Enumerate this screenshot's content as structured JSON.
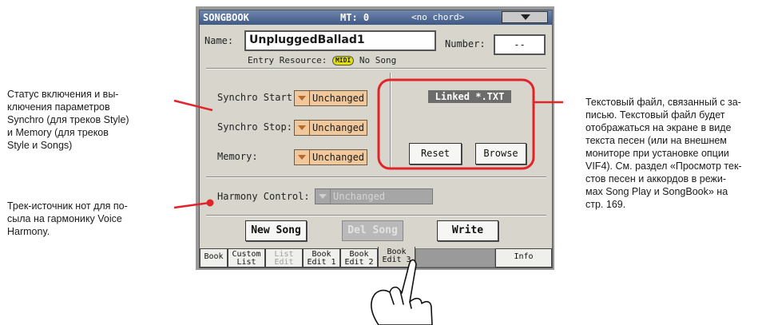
{
  "annotations": {
    "left_top": "Статус включения и вы-\nключения параметров\nSynchro (для треков Style)\nи Memory (для треков\nStyle и Songs)",
    "left_bottom": "Трек-источник нот для по-\nсыла на гармонику Voice\nHarmony.",
    "right": "Текстовый файл, связанный с за-\nписью.  Текстовый файл будет\nотображаться на экране в виде\nтекста песен (или на внешнем\nмониторе при установке опции\nVIF4). См. раздел «Просмотр тек-\nстов песен и аккордов в режи-\nмах Song Play и SongBook» на\nстр. 169."
  },
  "header": {
    "title": "SONGBOOK",
    "mt": "MT: 0",
    "chord": "<no chord>"
  },
  "entry": {
    "name_label": "Name:",
    "name_value": "UnpluggedBallad1",
    "number_label": "Number:",
    "number_value": "--",
    "resource_label": "Entry Resource:",
    "resource_badge": "MIDI",
    "resource_value": "No Song"
  },
  "params": {
    "synchro_start_label": "Synchro Start:",
    "synchro_start_value": "Unchanged",
    "synchro_stop_label": "Synchro Stop:",
    "synchro_stop_value": "Unchanged",
    "memory_label": "Memory:",
    "memory_value": "Unchanged",
    "harmony_label": "Harmony Control:",
    "harmony_value": "Unchanged"
  },
  "linked": {
    "title": "Linked *.TXT",
    "reset": "Reset",
    "browse": "Browse"
  },
  "actions": {
    "new_song": "New Song",
    "del_song": "Del Song",
    "write": "Write"
  },
  "tabs": [
    {
      "l1": "Book",
      "l2": ""
    },
    {
      "l1": "Custom",
      "l2": "List"
    },
    {
      "l1": "List",
      "l2": "Edit"
    },
    {
      "l1": "Book",
      "l2": "Edit 1"
    },
    {
      "l1": "Book",
      "l2": "Edit 2"
    },
    {
      "l1": "Book",
      "l2": "Edit 3"
    },
    {
      "l1": "",
      "l2": ""
    },
    {
      "l1": "Info",
      "l2": ""
    }
  ],
  "colors": {
    "callout_red": "#e0242a",
    "dropdown_fill": "#f0c89c",
    "title_bar": "#4a6590",
    "midi_badge": "#e2e100"
  }
}
